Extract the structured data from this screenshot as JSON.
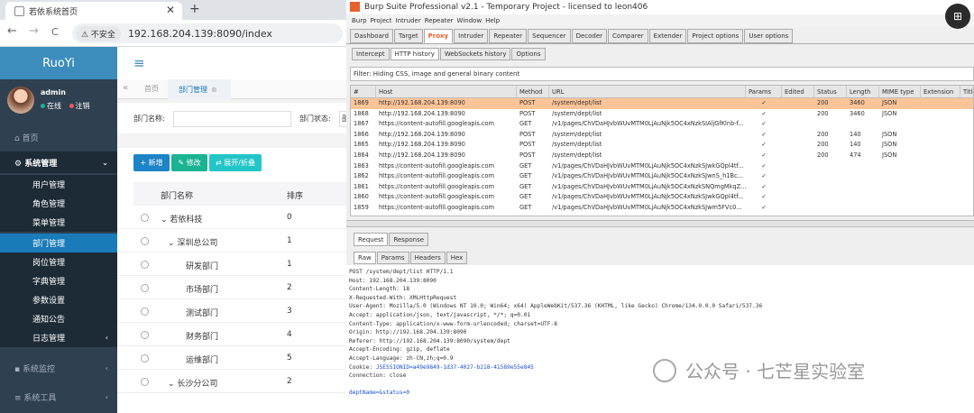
{
  "browser": {
    "tab_title": "若依系统首页",
    "tab_close": "✕",
    "new_tab": "+",
    "back": "←",
    "forward": "→",
    "reload": "C",
    "security": "⚠ 不安全",
    "url": "192.168.204.139:8090/index"
  },
  "ruoyi": {
    "brand": "RuoYi",
    "hamburger": "≡",
    "user_name": "admin",
    "status_online": "在线",
    "status_logout": "注销",
    "menu": [
      {
        "label": "⌂ 首页"
      },
      {
        "label": "⚙ 系统管理",
        "caret": "⌄"
      },
      {
        "label": "用户管理"
      },
      {
        "label": "角色管理"
      },
      {
        "label": "菜单管理"
      },
      {
        "label": "部门管理"
      },
      {
        "label": "岗位管理"
      },
      {
        "label": "字典管理"
      },
      {
        "label": "参数设置"
      },
      {
        "label": "通知公告"
      },
      {
        "label": "日志管理",
        "caret": "‹"
      },
      {
        "label": "▪ 系统监控",
        "caret": "‹"
      },
      {
        "label": "≡ 系统工具",
        "caret": "‹"
      }
    ],
    "tabs": {
      "nav": "«",
      "home": "首页",
      "current": "部门管理",
      "current_close": "⊗"
    },
    "search": {
      "dept_name_label": "部门名称:",
      "dept_status_label": "部门状态:",
      "dept_status_partial": "邵"
    },
    "buttons": {
      "add": "+ 新增",
      "edit": "✎ 修改",
      "expand": "⇄ 展开/折叠"
    },
    "table": {
      "headers": [
        "部门名称",
        "排序"
      ],
      "rows": [
        {
          "name": "⌄ 若依科技",
          "order": "0"
        },
        {
          "name": "⌄ 深圳总公司",
          "order": "1"
        },
        {
          "name": "研发部门",
          "order": "1"
        },
        {
          "name": "市场部门",
          "order": "2"
        },
        {
          "name": "测试部门",
          "order": "3"
        },
        {
          "name": "财务部门",
          "order": "4"
        },
        {
          "name": "运维部门",
          "order": "5"
        },
        {
          "name": "⌄ 长沙分公司",
          "order": "2"
        }
      ]
    }
  },
  "burp": {
    "title": "Burp Suite Professional v2.1 - Temporary Project - licensed to leon406",
    "menus": [
      "Burp",
      "Project",
      "Intruder",
      "Repeater",
      "Window",
      "Help"
    ],
    "top_tabs": [
      "Dashboard",
      "Target",
      "Proxy",
      "Intruder",
      "Repeater",
      "Sequencer",
      "Decoder",
      "Comparer",
      "Extender",
      "Project options",
      "User options"
    ],
    "top_tab_selected": "Proxy",
    "sub_tabs": [
      "Intercept",
      "HTTP history",
      "WebSockets history",
      "Options"
    ],
    "sub_tab_selected": "HTTP history",
    "filter": "Filter: Hiding CSS, image and general binary content",
    "history_headers": [
      "#",
      "Host",
      "Method",
      "URL",
      "Params",
      "Edited",
      "Status",
      "Length",
      "MIME type",
      "Extension",
      "Title"
    ],
    "history_rows": [
      {
        "num": "1869",
        "host": "http://192.168.204.139:8090",
        "method": "POST",
        "url": "/system/dept/list",
        "params": "✓",
        "status": "200",
        "length": "3460",
        "mime": "JSON",
        "selected": true
      },
      {
        "num": "1868",
        "host": "http://192.168.204.139:8090",
        "method": "POST",
        "url": "/system/dept/list",
        "params": "✓",
        "status": "200",
        "length": "3460",
        "mime": "JSON"
      },
      {
        "num": "1867",
        "host": "https://content-autofill.googleapis.com",
        "method": "GET",
        "url": "/v1/pages/ChVDaHJvbWUvMTM0LjAuNjk5OC4xNzkSIAljGfKlnb-f...",
        "params": "✓",
        "status": "",
        "length": "",
        "mime": ""
      },
      {
        "num": "1866",
        "host": "http://192.168.204.139:8090",
        "method": "POST",
        "url": "/system/dept/list",
        "params": "✓",
        "status": "200",
        "length": "140",
        "mime": "JSON"
      },
      {
        "num": "1865",
        "host": "http://192.168.204.139:8090",
        "method": "POST",
        "url": "/system/dept/list",
        "params": "✓",
        "status": "200",
        "length": "140",
        "mime": "JSON"
      },
      {
        "num": "1864",
        "host": "http://192.168.204.139:8090",
        "method": "POST",
        "url": "/system/dept/list",
        "params": "✓",
        "status": "200",
        "length": "474",
        "mime": "JSON"
      },
      {
        "num": "1863",
        "host": "https://content-autofill.googleapis.com",
        "method": "GET",
        "url": "/v1/pages/ChVDaHJvbWUvMTM0LjAuNjk5OC4xNzkSJwkGQpl4tf...",
        "params": "✓",
        "status": "",
        "length": "",
        "mime": ""
      },
      {
        "num": "1862",
        "host": "https://content-autofill.googleapis.com",
        "method": "GET",
        "url": "/v1/pages/ChVDaHJvbWUvMTM0LjAuNjk5OC4xNzkSJwnS_h1Bc...",
        "params": "✓",
        "status": "",
        "length": "",
        "mime": ""
      },
      {
        "num": "1861",
        "host": "https://content-autofill.googleapis.com",
        "method": "GET",
        "url": "/v1/pages/ChVDaHJvbWUvMTM0LjAuNjk5OC4xNzkSNQmgMkqZ...",
        "params": "✓",
        "status": "",
        "length": "",
        "mime": ""
      },
      {
        "num": "1860",
        "host": "https://content-autofill.googleapis.com",
        "method": "GET",
        "url": "/v1/pages/ChVDaHJvbWUvMTM0LjAuNjk5OC4xNzkSJwkGQpl4tf...",
        "params": "✓",
        "status": "",
        "length": "",
        "mime": ""
      },
      {
        "num": "1859",
        "host": "https://content-autofill.googleapis.com",
        "method": "GET",
        "url": "/v1/pages/ChVDaHJvbWUvMTM0LjAuNjk5OC4xNzkSJwm5FVc0...",
        "params": "✓",
        "status": "",
        "length": "",
        "mime": ""
      }
    ],
    "req_tabs": [
      "Request",
      "Response"
    ],
    "raw_tabs": [
      "Raw",
      "Params",
      "Headers",
      "Hex"
    ],
    "request_lines": [
      "POST /system/dept/list HTTP/1.1",
      "Host: 192.168.204.139:8090",
      "Content-Length: 18",
      "X-Requested-With: XMLHttpRequest",
      "User-Agent: Mozilla/5.0 (Windows NT 10.0; Win64; x64) AppleWebKit/537.36 (KHTML, like Gecko) Chrome/134.0.0.0 Safari/537.36",
      "Accept: application/json, text/javascript, */*; q=0.01",
      "Content-Type: application/x-www-form-urlencoded; charset=UTF-8",
      "Origin: http://192.168.204.139:8090",
      "Referer: http://192.168.204.139:8090/system/dept",
      "Accept-Encoding: gzip, deflate",
      "Accept-Language: zh-CN,zh;q=0.9",
      "Cookie: JSESSIONID=a49e9849-1d37-4027-b218-41589e55e845",
      "Connection: close",
      "",
      "deptName=&status=0"
    ],
    "colors": {
      "accent": "#e8612c",
      "selected_row": "#fdc497",
      "cookie": "#1a4fd6"
    }
  },
  "watermark": "公众号 · 七芒星实验室",
  "corner_button": "⊞"
}
